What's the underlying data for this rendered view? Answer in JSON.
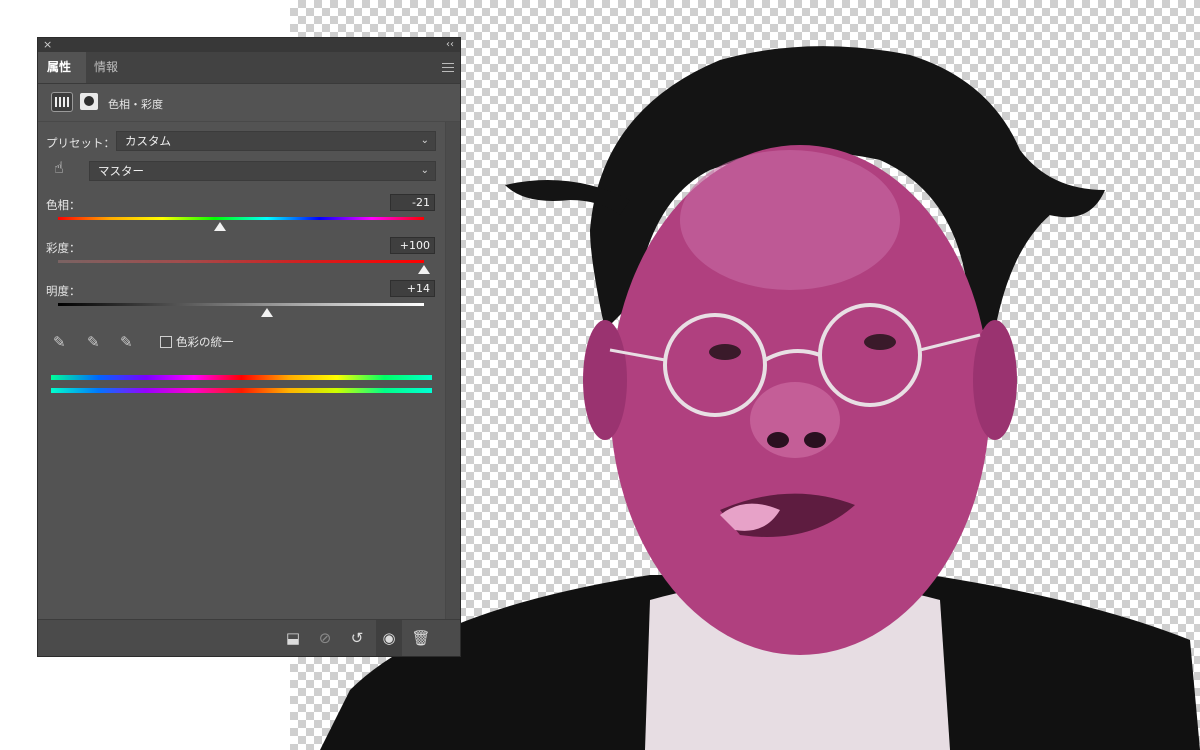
{
  "window": {
    "close_glyph": "×",
    "collapse_glyph": "‹‹"
  },
  "tabs": [
    {
      "label": "属性",
      "active": true
    },
    {
      "label": "情報",
      "active": false
    }
  ],
  "header": {
    "title": "色相・彩度",
    "icons": [
      "adjustment-layer-icon",
      "layer-mask-icon"
    ]
  },
  "preset": {
    "label": "プリセット：",
    "value": "カスタム"
  },
  "channel": {
    "value": "マスター"
  },
  "sliders": {
    "hue": {
      "label": "色相：",
      "value": "-21",
      "numeric": -21,
      "min": -180,
      "max": 180
    },
    "saturation": {
      "label": "彩度：",
      "value": "+100",
      "numeric": 100,
      "min": -100,
      "max": 100
    },
    "lightness": {
      "label": "明度：",
      "value": "+14",
      "numeric": 14,
      "min": -100,
      "max": 100
    }
  },
  "colorize": {
    "label": "色彩の統一",
    "checked": false
  },
  "footer_buttons": [
    "clip-to-layer-icon",
    "view-previous-state-icon",
    "reset-icon",
    "visibility-eye-icon",
    "trash-icon"
  ],
  "colors": {
    "panel_bg": "#535353",
    "image_tint": "#b0407f"
  }
}
